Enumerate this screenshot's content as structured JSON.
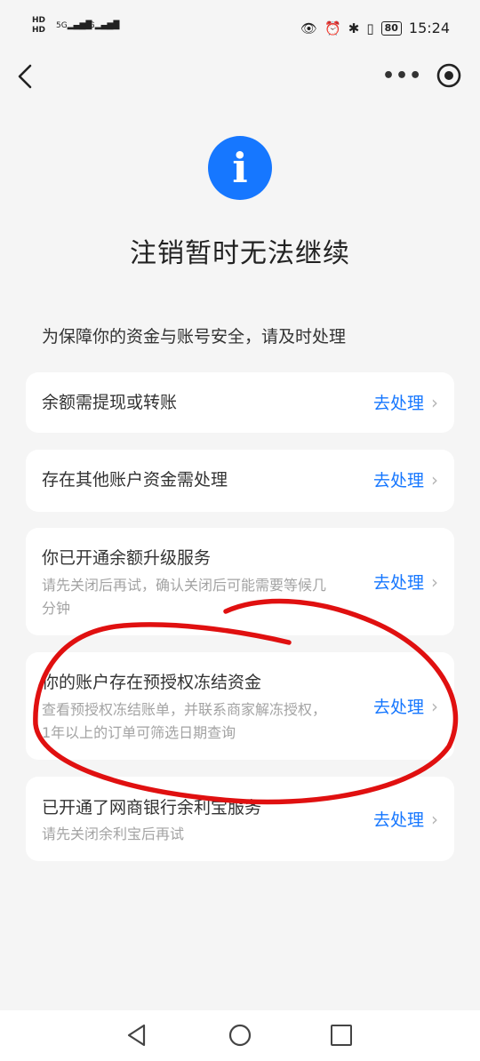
{
  "status": {
    "left_top": "HD",
    "left_bottom": "HD",
    "sig1": "5G",
    "sig2": "4G",
    "battery": "80",
    "time": "15:24"
  },
  "page": {
    "title": "注销暂时无法继续",
    "subtitle": "为保障你的资金与账号安全，请及时处理"
  },
  "items": [
    {
      "title": "余额需提现或转账",
      "desc": "",
      "action": "去处理"
    },
    {
      "title": "存在其他账户资金需处理",
      "desc": "",
      "action": "去处理"
    },
    {
      "title": "你已开通余额升级服务",
      "desc": "请先关闭后再试，确认关闭后可能需要等候几分钟",
      "action": "去处理"
    },
    {
      "title": "你的账户存在预授权冻结资金",
      "desc": "查看预授权冻结账单，并联系商家解冻授权，1年以上的订单可筛选日期查询",
      "action": "去处理"
    },
    {
      "title": "已开通了网商银行余利宝服务",
      "desc": "请先关闭余利宝后再试",
      "action": "去处理"
    }
  ],
  "icons": {
    "info": "i",
    "more": "•••",
    "chevron": "›"
  },
  "colors": {
    "accent": "#1677ff",
    "annotation": "#e01010"
  }
}
